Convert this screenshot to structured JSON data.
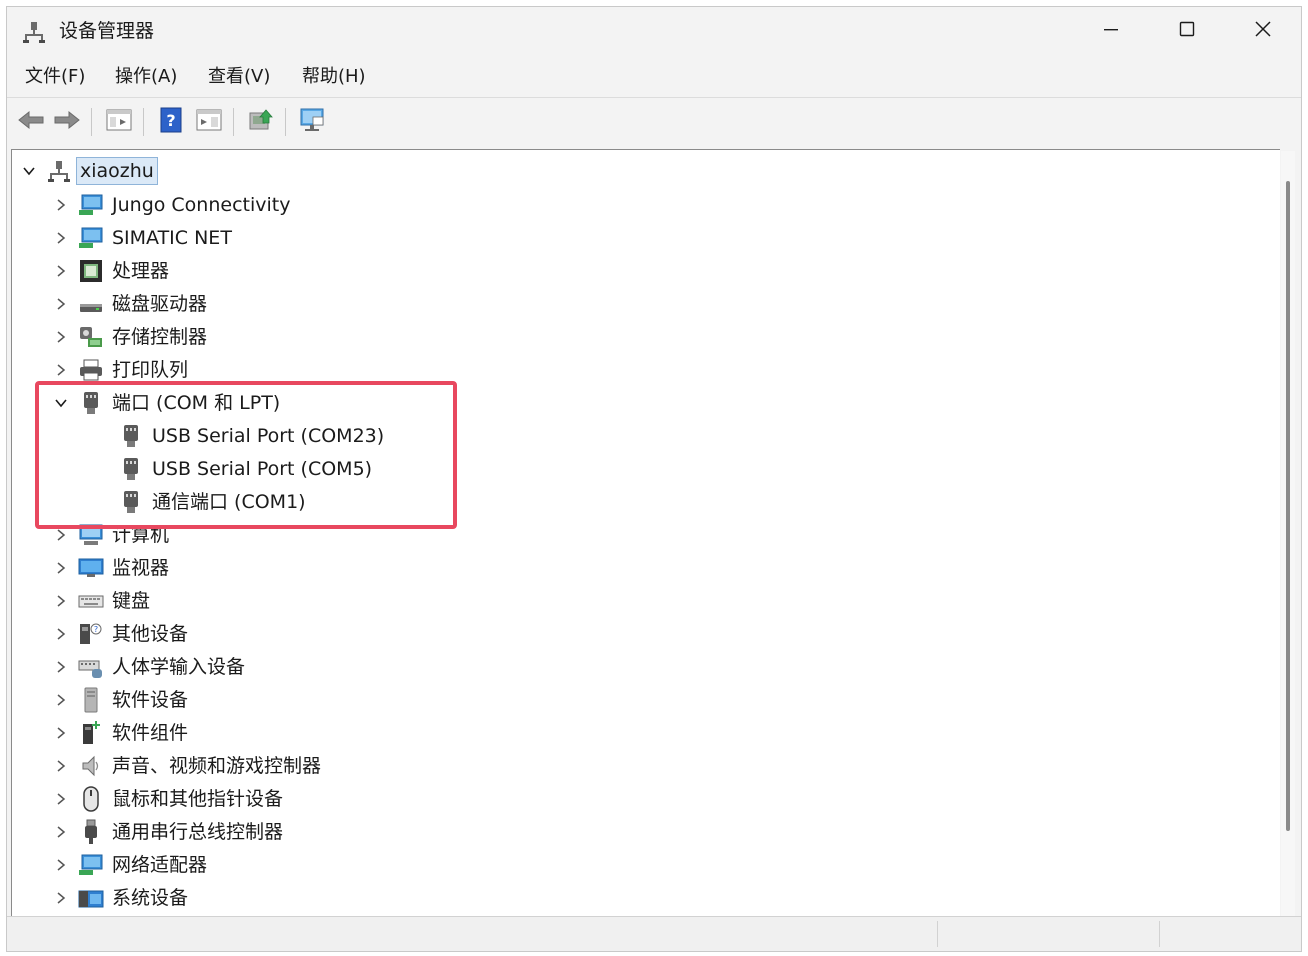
{
  "window": {
    "title": "设备管理器"
  },
  "menu": [
    {
      "label": "文件(F)"
    },
    {
      "label": "操作(A)"
    },
    {
      "label": "查看(V)"
    },
    {
      "label": "帮助(H)"
    }
  ],
  "toolbar": [
    {
      "icon": "back-arrow-icon"
    },
    {
      "icon": "forward-arrow-icon"
    },
    {
      "icon": "properties-view-icon"
    },
    {
      "icon": "help-icon"
    },
    {
      "icon": "run-view-icon"
    },
    {
      "icon": "update-driver-icon"
    },
    {
      "icon": "monitor-scan-icon"
    }
  ],
  "tree": {
    "root": "xiaozhu",
    "items": [
      {
        "label": "Jungo Connectivity",
        "icon": "network-icon",
        "expanded": false
      },
      {
        "label": "SIMATIC NET",
        "icon": "network-icon",
        "expanded": false
      },
      {
        "label": "处理器",
        "icon": "processor-icon",
        "expanded": false
      },
      {
        "label": "磁盘驱动器",
        "icon": "disk-drive-icon",
        "expanded": false
      },
      {
        "label": "存储控制器",
        "icon": "storage-controller-icon",
        "expanded": false
      },
      {
        "label": "打印队列",
        "icon": "printer-icon",
        "expanded": false
      },
      {
        "label": "端口 (COM 和 LPT)",
        "icon": "port-icon",
        "expanded": true,
        "children": [
          {
            "label": "USB Serial Port (COM23)",
            "icon": "port-icon"
          },
          {
            "label": "USB Serial Port (COM5)",
            "icon": "port-icon"
          },
          {
            "label": "通信端口 (COM1)",
            "icon": "port-icon"
          }
        ]
      },
      {
        "label": "计算机",
        "icon": "computer-icon",
        "expanded": false
      },
      {
        "label": "监视器",
        "icon": "monitor-icon",
        "expanded": false
      },
      {
        "label": "键盘",
        "icon": "keyboard-icon",
        "expanded": false
      },
      {
        "label": "其他设备",
        "icon": "other-device-icon",
        "expanded": false
      },
      {
        "label": "人体学输入设备",
        "icon": "hid-icon",
        "expanded": false
      },
      {
        "label": "软件设备",
        "icon": "software-device-icon",
        "expanded": false
      },
      {
        "label": "软件组件",
        "icon": "software-component-icon",
        "expanded": false
      },
      {
        "label": "声音、视频和游戏控制器",
        "icon": "speaker-icon",
        "expanded": false
      },
      {
        "label": "鼠标和其他指针设备",
        "icon": "mouse-icon",
        "expanded": false
      },
      {
        "label": "通用串行总线控制器",
        "icon": "usb-icon",
        "expanded": false
      },
      {
        "label": "网络适配器",
        "icon": "network-adapter-icon",
        "expanded": false
      },
      {
        "label": "系统设备",
        "icon": "system-device-icon",
        "expanded": false
      }
    ]
  },
  "colors": {
    "highlight": "#e8485f",
    "selection_bg": "#dbe9f7",
    "selection_border": "#8fb4d9"
  }
}
